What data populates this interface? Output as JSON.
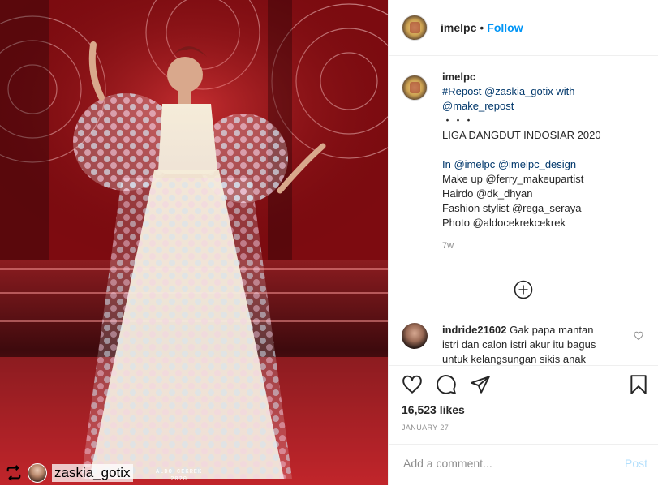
{
  "post": {
    "author": "imelpc",
    "separator": "•",
    "follow_label": "Follow",
    "caption": {
      "lines": [
        "#Repost @zaskia_gotix with",
        "@make_repost",
        "・・・",
        "LIGA DANGDUT INDOSIAR 2020",
        "",
        "In @imelpc @imelpc_design",
        "Make up @ferry_makeupartist",
        "Hairdo @dk_dhyan",
        "Fashion stylist @rega_seraya",
        "Photo @aldocekrekcekrek"
      ],
      "age": "7w"
    },
    "comment": {
      "user": "indride21602",
      "text": "Gak papa mantan istri dan calon istri akur itu bagus untuk kelangsungan sikis anak"
    },
    "likes": "16,523 likes",
    "date": "JANUARY 27",
    "add_comment_placeholder": "Add a comment...",
    "post_label": "Post"
  },
  "photo": {
    "repost_user": "zaskia_gotix",
    "watermark_line1": "ALDO CEKREK",
    "watermark_line2": "2020"
  },
  "colors": {
    "link": "#00376b",
    "follow": "#0095f6",
    "post_disabled": "#b2dffc",
    "muted": "#8e8e8e"
  },
  "icons": [
    "heart-icon",
    "comment-icon",
    "share-icon",
    "bookmark-icon",
    "plus-circle-icon",
    "repost-icon",
    "like-comment-icon"
  ]
}
